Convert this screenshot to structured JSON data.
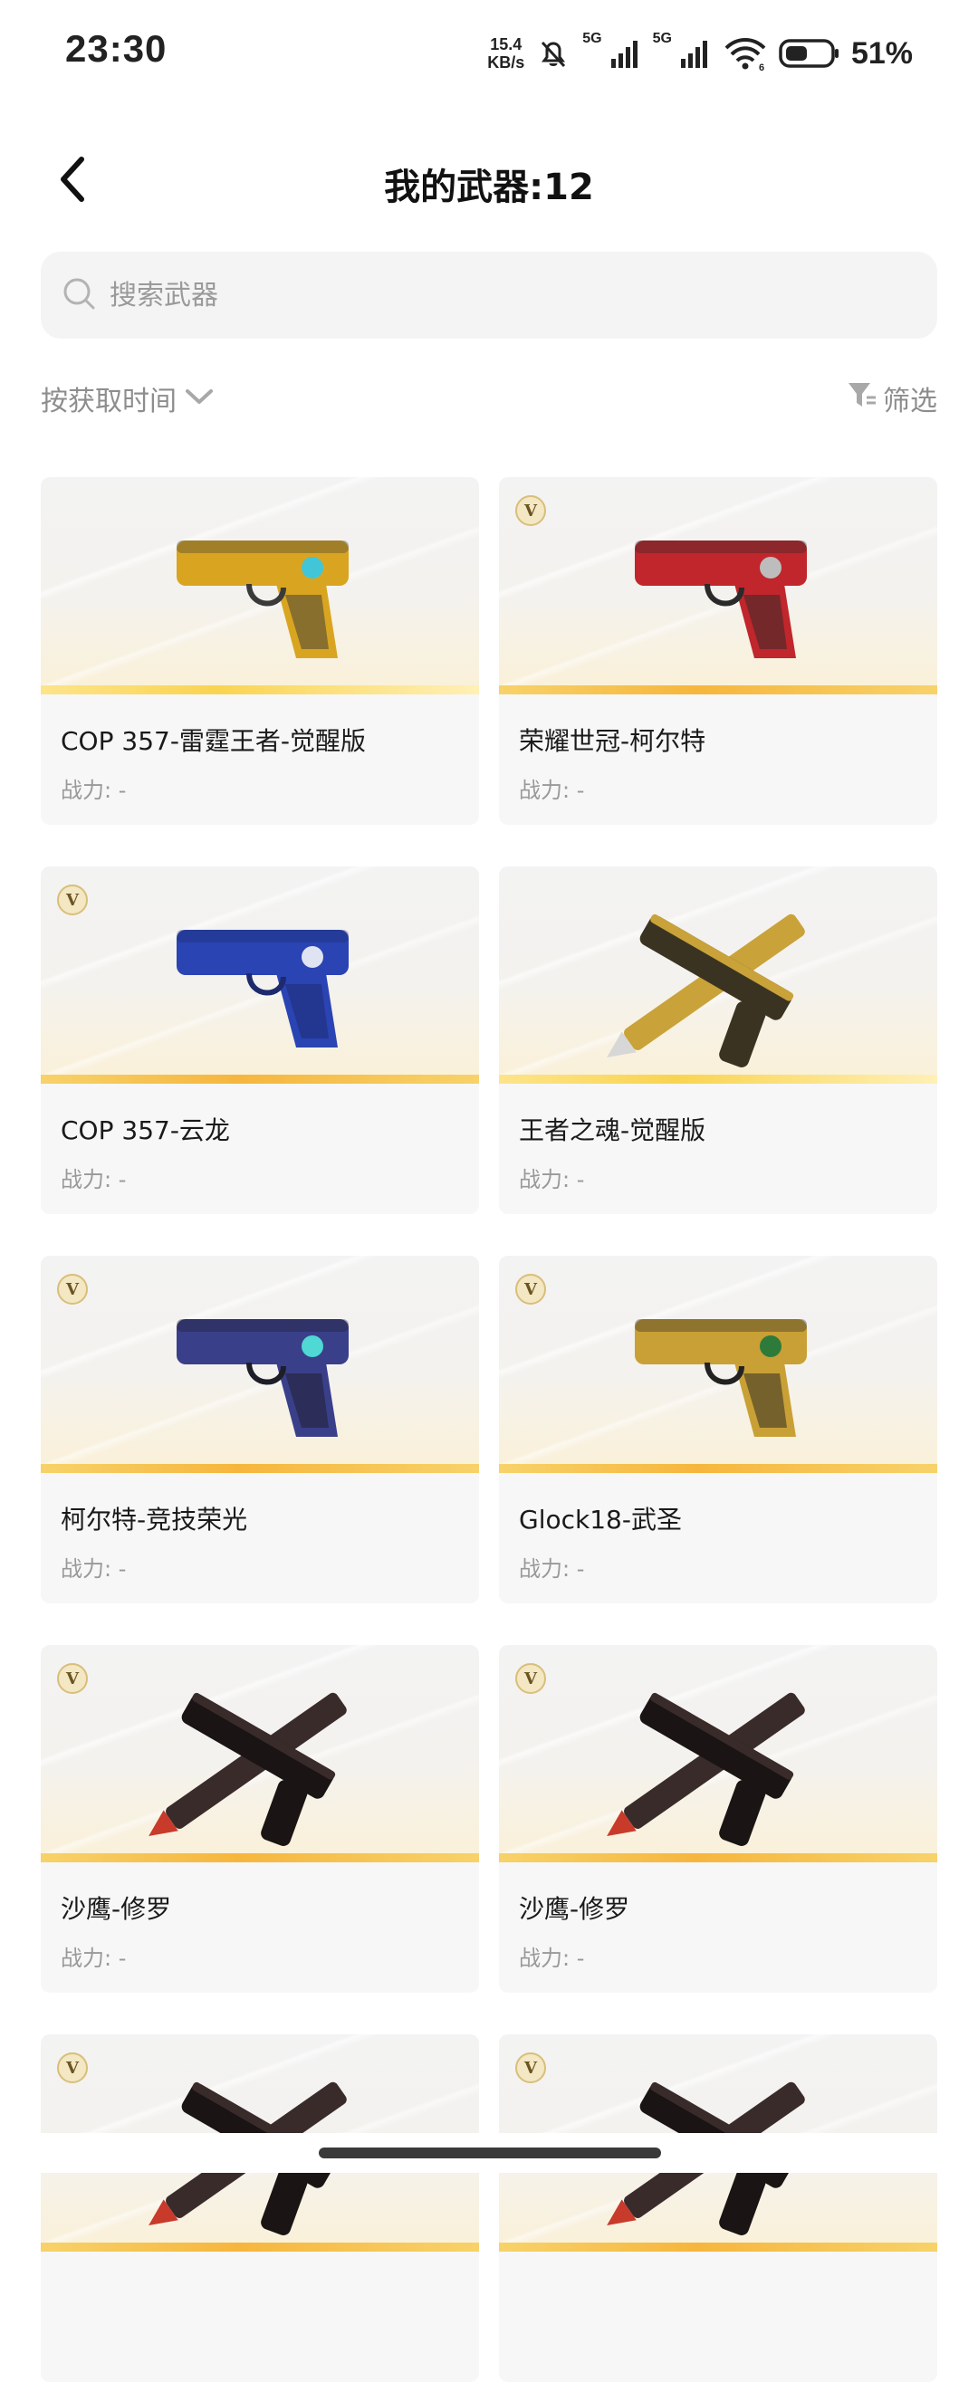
{
  "status_bar": {
    "time": "23:30",
    "speed_value": "15.4",
    "speed_unit": "KB/s",
    "sim1": "5G",
    "sim2": "5G",
    "wifi_badge": "6",
    "battery_pct": "51%",
    "battery_level": 0.51
  },
  "header": {
    "title": "我的武器:12"
  },
  "search": {
    "placeholder": "搜索武器"
  },
  "toolbar": {
    "sort_label": "按获取时间",
    "filter_label": "筛选"
  },
  "weapons": [
    {
      "name": "COP 357-雷霆王者-觉醒版",
      "power": "战力: -",
      "badge": "",
      "palette": {
        "main": "#d9a521",
        "accent": "#41c6d9",
        "dark": "#3a3a3a"
      }
    },
    {
      "name": "荣耀世冠-柯尔特",
      "power": "战力: -",
      "badge": "V",
      "palette": {
        "main": "#c0262b",
        "accent": "#bdbdbd",
        "dark": "#2a2a2a"
      }
    },
    {
      "name": "COP 357-云龙",
      "power": "战力: -",
      "badge": "V",
      "palette": {
        "main": "#2a44b3",
        "accent": "#e0e4f2",
        "dark": "#1d2a6e"
      }
    },
    {
      "name": "王者之魂-觉醒版",
      "power": "战力: -",
      "badge": "",
      "palette": {
        "main": "#c9a239",
        "accent": "#d7d7d7",
        "dark": "#3b3322"
      }
    },
    {
      "name": "柯尔特-竞技荣光",
      "power": "战力: -",
      "badge": "V",
      "palette": {
        "main": "#3a3f8a",
        "accent": "#4fd8d4",
        "dark": "#1e1e28"
      }
    },
    {
      "name": "Glock18-武圣",
      "power": "战力: -",
      "badge": "V",
      "palette": {
        "main": "#c8a035",
        "accent": "#2e7a3a",
        "dark": "#222222"
      }
    },
    {
      "name": "沙鹰-修罗",
      "power": "战力: -",
      "badge": "V",
      "palette": {
        "main": "#3a2b2b",
        "accent": "#c83a2a",
        "dark": "#1a1414"
      }
    },
    {
      "name": "沙鹰-修罗",
      "power": "战力: -",
      "badge": "V",
      "palette": {
        "main": "#3a2b2b",
        "accent": "#c83a2a",
        "dark": "#1a1414"
      }
    },
    {
      "name": "",
      "power": "",
      "badge": "V",
      "palette": {
        "main": "#3a2b2b",
        "accent": "#c83a2a",
        "dark": "#1a1414"
      }
    },
    {
      "name": "",
      "power": "",
      "badge": "V",
      "palette": {
        "main": "#3a2b2b",
        "accent": "#c83a2a",
        "dark": "#1a1414"
      }
    }
  ],
  "icons": {
    "back": "chevron-left-icon",
    "search": "search-icon",
    "sort": "chevron-down-icon",
    "filter": "filter-icon"
  }
}
